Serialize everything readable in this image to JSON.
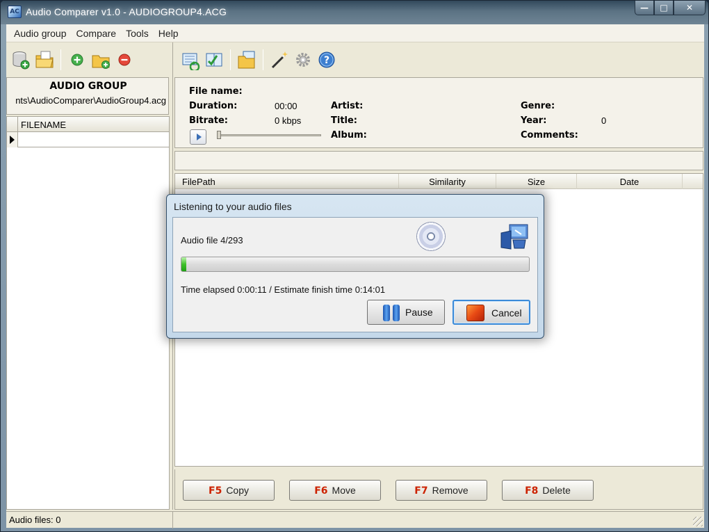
{
  "window": {
    "title": "Audio Comparer v1.0 - AUDIOGROUP4.ACG",
    "app_icon_text": "AC",
    "controls": {
      "minimize": "—",
      "maximize": "□",
      "close": "✕"
    }
  },
  "menu": [
    "Audio group",
    "Compare",
    "Tools",
    "Help"
  ],
  "left_toolbar": [
    "new-group-icon",
    "open-group-icon",
    "add-file-icon",
    "add-folder-icon",
    "remove-icon"
  ],
  "right_toolbar": [
    "refresh-compare-icon",
    "compare-icon",
    "copy-list-icon",
    "wizard-icon",
    "settings-icon",
    "help-icon"
  ],
  "audio_group": {
    "title": "AUDIO GROUP",
    "path": "nts\\AudioComparer\\AudioGroup4.acg",
    "column": "FILENAME"
  },
  "info": {
    "file_name_label": "File name:",
    "duration_label": "Duration:",
    "duration_value": "00:00",
    "bitrate_label": "Bitrate:",
    "bitrate_value": "0 kbps",
    "artist_label": "Artist:",
    "title_label": "Title:",
    "album_label": "Album:",
    "genre_label": "Genre:",
    "year_label": "Year:",
    "year_value": "0",
    "comments_label": "Comments:"
  },
  "results": {
    "columns": [
      "FilePath",
      "Similarity",
      "Size",
      "Date"
    ]
  },
  "actions": [
    {
      "key": "F5",
      "label": "Copy"
    },
    {
      "key": "F6",
      "label": "Move"
    },
    {
      "key": "F7",
      "label": "Remove"
    },
    {
      "key": "F8",
      "label": "Delete"
    }
  ],
  "status": {
    "left": "Audio files: 0"
  },
  "dialog": {
    "title": "Listening to your audio files",
    "progress_text": "Audio file 4/293",
    "progress_fraction": 0.0137,
    "time_text": "Time elapsed  0:00:11 / Estimate finish time  0:14:01",
    "pause_label": "Pause",
    "cancel_label": "Cancel"
  },
  "colors": {
    "accent_key": "#cc2200",
    "progress_green": "#3fc02a"
  }
}
